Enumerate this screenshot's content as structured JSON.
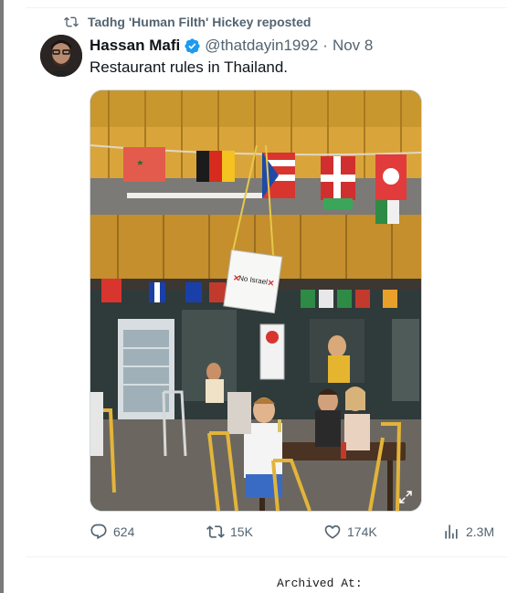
{
  "repost": {
    "icon": "repost-icon",
    "text": "Tadhg 'Human Filth' Hickey reposted"
  },
  "tweet": {
    "author_name": "Hassan Mafi",
    "verified_icon": "verified-badge-icon",
    "handle": "@thatdayin1992",
    "separator": "·",
    "date": "Nov 8",
    "text": "Restaurant rules in Thailand.",
    "image": {
      "icon": "photo",
      "sign_text": "No Israel",
      "expand_icon": "expand-icon"
    }
  },
  "actions": {
    "replies": "624",
    "reposts": "15K",
    "likes": "174K",
    "views": "2.3M"
  },
  "footer": {
    "archived_label": "Archived At:"
  },
  "colors": {
    "muted": "#536471",
    "verified": "#1d9bf0",
    "text": "#0f1419"
  }
}
